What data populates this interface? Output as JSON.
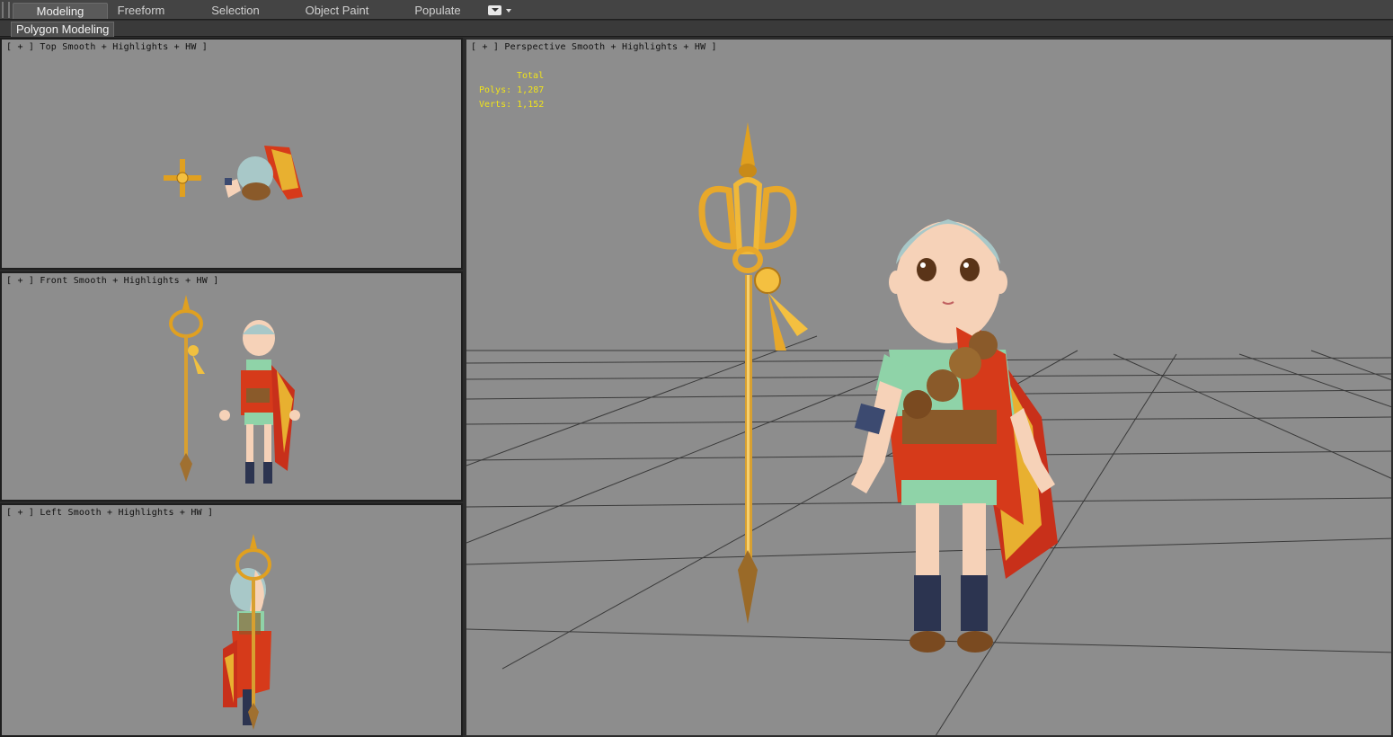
{
  "ribbon": {
    "tabs": [
      {
        "label": "Modeling",
        "active": true
      },
      {
        "label": "Freeform",
        "active": false
      },
      {
        "label": "Selection",
        "active": false
      },
      {
        "label": "Object Paint",
        "active": false
      },
      {
        "label": "Populate",
        "active": false
      }
    ],
    "options_icon": "ribbon-options-icon"
  },
  "subbar": {
    "panel_label": "Polygon Modeling"
  },
  "viewports": {
    "top": {
      "plus": "[ + ]",
      "view": "Top",
      "shading": "Smooth + Highlights + HW ]"
    },
    "front": {
      "plus": "[ + ]",
      "view": "Front",
      "shading": "Smooth + Highlights + HW ]"
    },
    "left": {
      "plus": "[ + ]",
      "view": "Left",
      "shading": "Smooth + Highlights + HW ]"
    },
    "perspective": {
      "plus": "[ + ]",
      "view": "Perspective",
      "shading": "Smooth + Highlights + HW ]"
    }
  },
  "stats": {
    "header": "Total",
    "polys_label": "Polys:",
    "polys_value": "1,287",
    "verts_label": "Verts:",
    "verts_value": "1,152"
  },
  "colors": {
    "viewport_bg": "#8d8d8d",
    "stats_text": "#f0e31a",
    "staff_gold": "#e0a020",
    "robe_red": "#d63a1a",
    "shirt_green": "#8fd3a8",
    "skin": "#f6d2b8",
    "hair": "#a8c8c8"
  }
}
